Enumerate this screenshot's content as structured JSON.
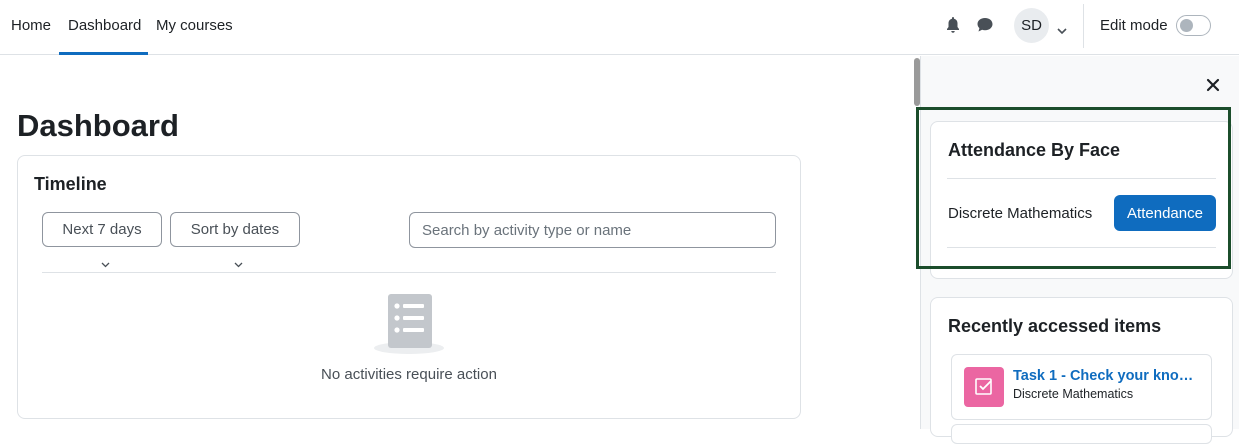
{
  "nav": {
    "items": [
      {
        "label": "Home"
      },
      {
        "label": "Dashboard",
        "active": true
      },
      {
        "label": "My courses"
      }
    ],
    "icons": {
      "notifications": "bell-icon",
      "messages": "chat-bubble-icon"
    },
    "user_initials": "SD",
    "edit_mode_label": "Edit mode",
    "edit_mode_on": false
  },
  "main": {
    "page_title": "Dashboard",
    "timeline": {
      "title": "Timeline",
      "filter_label": "Next 7 days",
      "sort_label": "Sort by dates",
      "search_placeholder": "Search by activity type or name",
      "empty_message": "No activities require action"
    }
  },
  "drawer": {
    "attendance_block": {
      "title": "Attendance By Face",
      "course_name": "Discrete Mathematics",
      "button_label": "Attendance"
    },
    "recent_block": {
      "title": "Recently accessed items",
      "items": [
        {
          "title": "Task 1 - Check your kno…",
          "course": "Discrete Mathematics",
          "icon": "assignment-check-icon"
        }
      ]
    }
  },
  "colors": {
    "primary": "#0f6cbf",
    "highlight_border": "#1b4d2b",
    "assignment_icon_bg": "#eb66a2"
  }
}
